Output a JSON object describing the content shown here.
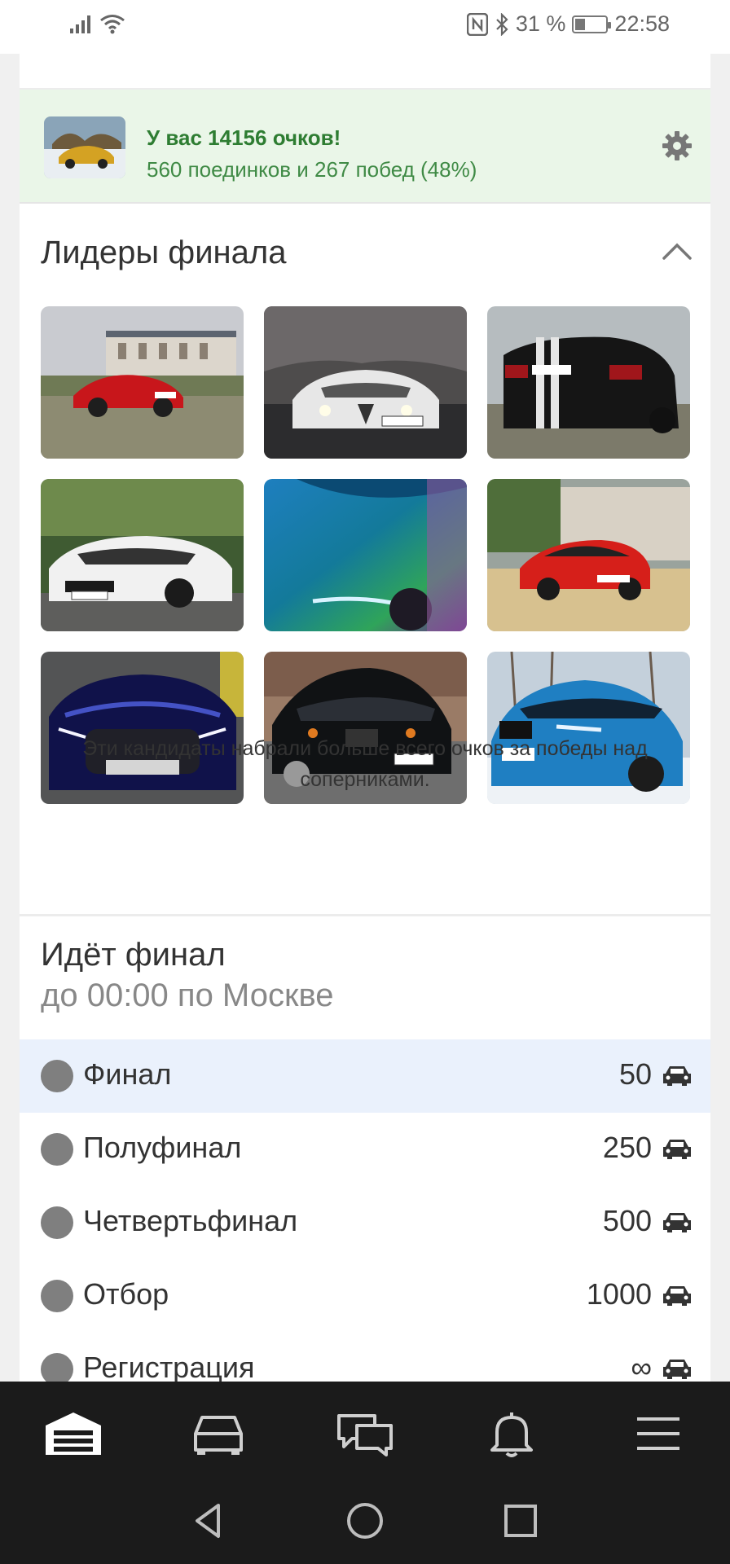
{
  "status_bar": {
    "battery_percent": "31 %",
    "time": "22:58",
    "icons": [
      "signal-icon",
      "wifi-icon",
      "nfc-icon",
      "bluetooth-icon",
      "battery-icon"
    ]
  },
  "score": {
    "title": "У вас 14156 очков!",
    "subtitle": "560 поединков и 267 побед (48%)"
  },
  "leaders": {
    "title": "Лидеры финала",
    "caption": "Эти кандидаты набрали больше всего очков за победы над соперниками."
  },
  "final": {
    "title": "Идёт финал",
    "subtitle": "до 00:00 по Москве",
    "stages": [
      {
        "name": "Финал",
        "count": "50",
        "active": true
      },
      {
        "name": "Полуфинал",
        "count": "250",
        "active": false
      },
      {
        "name": "Четвертьфинал",
        "count": "500",
        "active": false
      },
      {
        "name": "Отбор",
        "count": "1000",
        "active": false
      },
      {
        "name": "Регистрация",
        "count": "∞",
        "active": false
      }
    ]
  },
  "bottom_nav": {
    "items": [
      "garage-icon",
      "car-icon",
      "chat-icon",
      "bell-icon",
      "menu-icon"
    ]
  },
  "system_nav": {
    "items": [
      "back-icon",
      "home-icon",
      "recents-icon"
    ]
  },
  "colors": {
    "score_bg": "#eaf6e8",
    "score_text": "#2e7d32",
    "active_stage_bg": "#eaf1fc",
    "nav_bg": "#1b1b1b"
  }
}
